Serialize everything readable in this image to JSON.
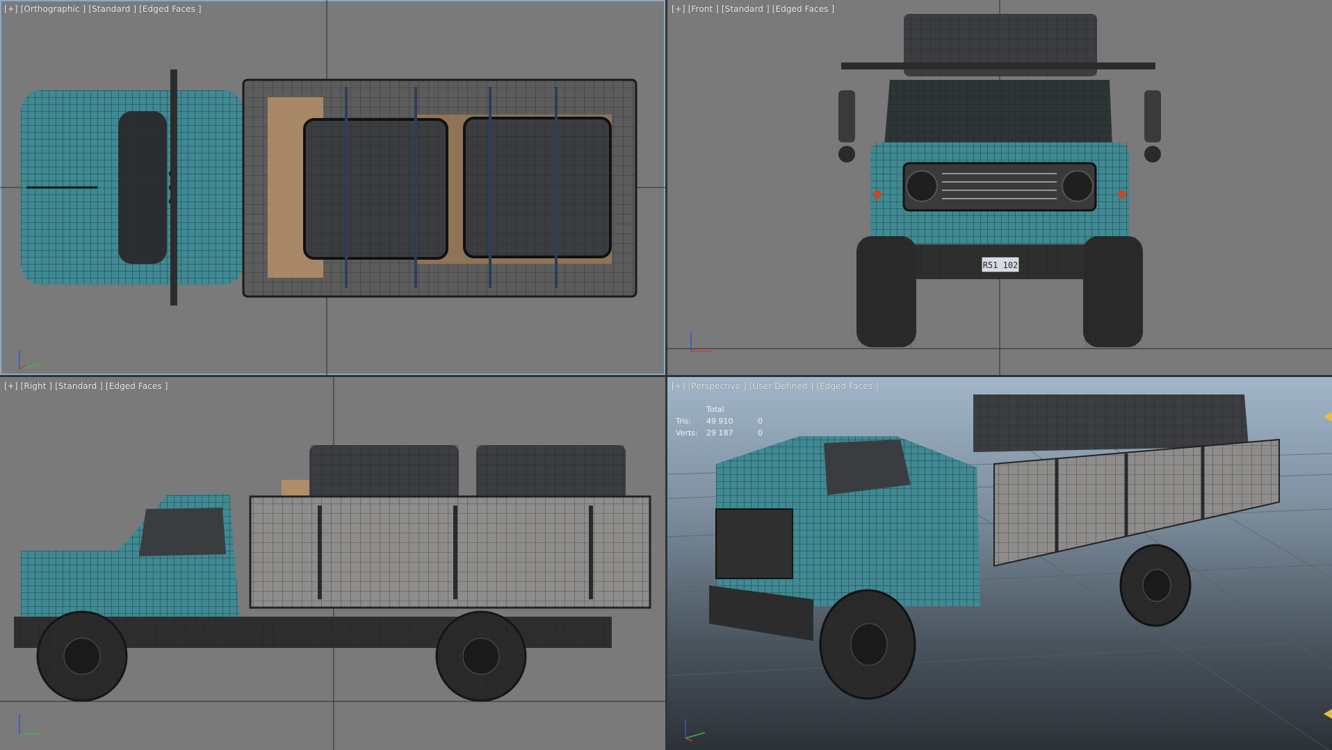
{
  "viewports": {
    "top": {
      "label": "[+] [Orthographic ] [Standard ] [Edged Faces ]"
    },
    "front": {
      "label": "[+] [Front ] [Standard ] [Edged Faces ]",
      "plate": "R51 102"
    },
    "right": {
      "label": "[+] [Right ] [Standard ] [Edged Faces ]"
    },
    "perspective": {
      "label": "[+] [Perspective ] [User Defined ] [Edged Faces ]",
      "stats": {
        "header": "Total",
        "tris_label": "Tris:",
        "tris_value": "49 910",
        "tris_sel": "0",
        "verts_label": "Verts:",
        "verts_value": "29 187",
        "verts_sel": "0"
      }
    }
  },
  "axis_icons": [
    "axis-gizmo-icon",
    "camera-marker-icon"
  ],
  "colors": {
    "viewport_bg": "#7a7a7a",
    "active_border": "#8fa8c6",
    "cab_teal": "#3f8a94",
    "tarp_dark": "#3b3d40",
    "bed_gray": "#8e8d8b",
    "crate_wood": "#b08d68"
  }
}
